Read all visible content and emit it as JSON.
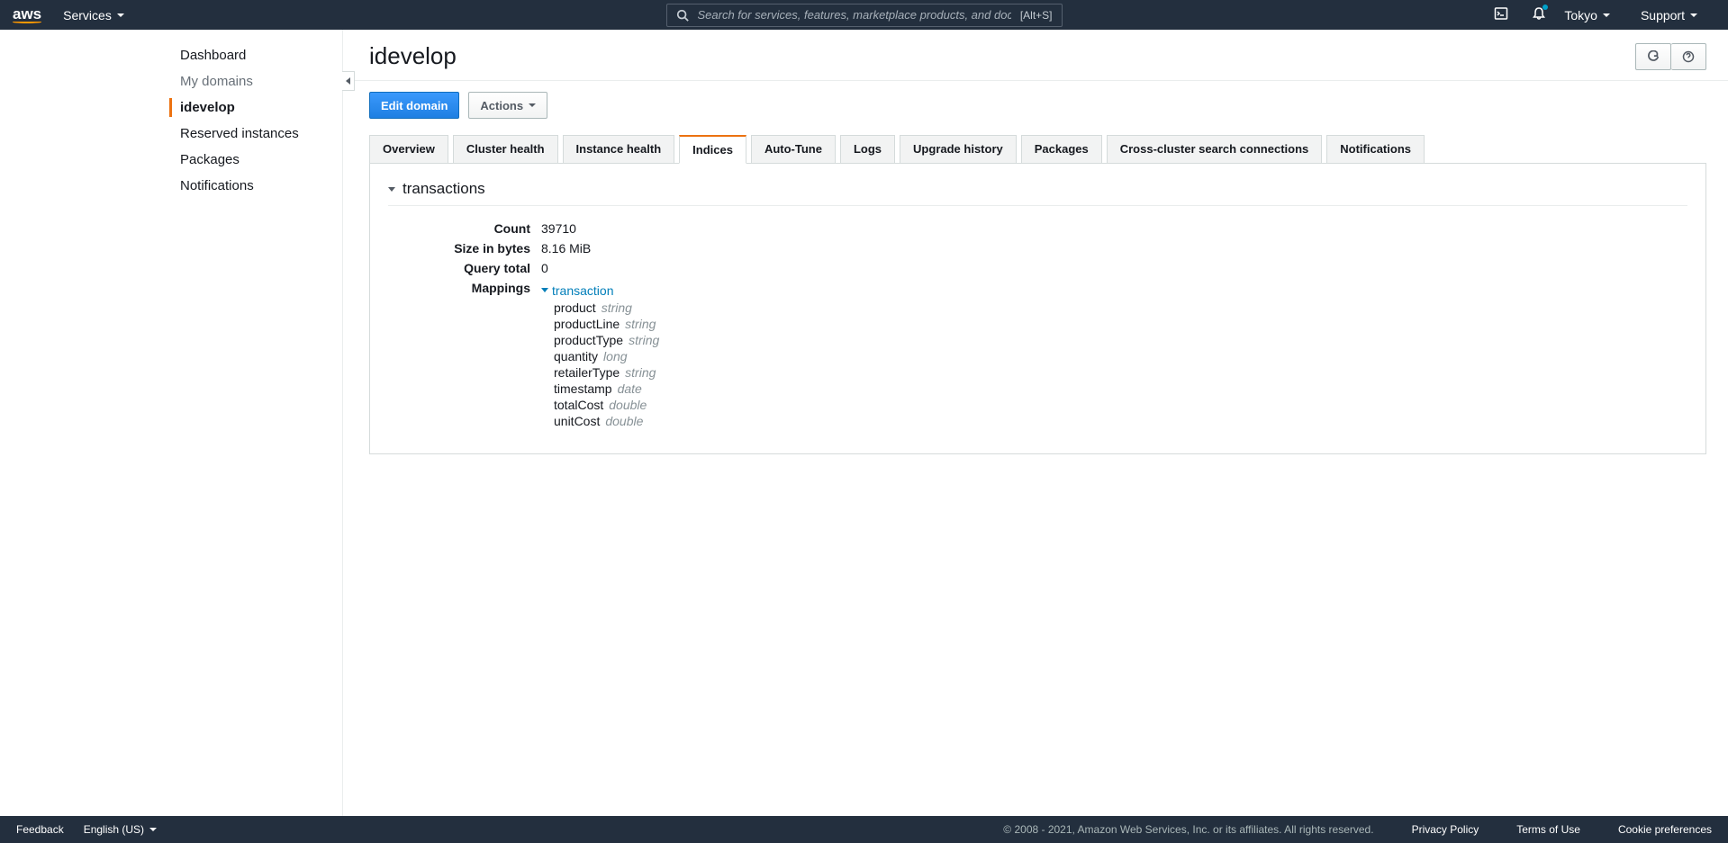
{
  "topnav": {
    "services_label": "Services",
    "search_placeholder": "Search for services, features, marketplace products, and docs",
    "search_shortcut": "[Alt+S]",
    "region": "Tokyo",
    "support": "Support"
  },
  "sidebar": {
    "items": [
      {
        "label": "Dashboard",
        "active": false,
        "muted": false
      },
      {
        "label": "My domains",
        "active": false,
        "muted": true
      },
      {
        "label": "idevelop",
        "active": true,
        "muted": false
      },
      {
        "label": "Reserved instances",
        "active": false,
        "muted": false
      },
      {
        "label": "Packages",
        "active": false,
        "muted": false
      },
      {
        "label": "Notifications",
        "active": false,
        "muted": false
      }
    ]
  },
  "page": {
    "title": "idevelop",
    "edit_button": "Edit domain",
    "actions_button": "Actions"
  },
  "tabs": [
    {
      "label": "Overview",
      "active": false
    },
    {
      "label": "Cluster health",
      "active": false
    },
    {
      "label": "Instance health",
      "active": false
    },
    {
      "label": "Indices",
      "active": true
    },
    {
      "label": "Auto-Tune",
      "active": false
    },
    {
      "label": "Logs",
      "active": false
    },
    {
      "label": "Upgrade history",
      "active": false
    },
    {
      "label": "Packages",
      "active": false
    },
    {
      "label": "Cross-cluster search connections",
      "active": false
    },
    {
      "label": "Notifications",
      "active": false
    }
  ],
  "index": {
    "name": "transactions",
    "fields": {
      "count_label": "Count",
      "count_value": "39710",
      "size_label": "Size in bytes",
      "size_value": "8.16 MiB",
      "query_label": "Query total",
      "query_value": "0",
      "mappings_label": "Mappings"
    },
    "mapping_type_name": "transaction",
    "mapping_fields": [
      {
        "name": "product",
        "type": "string"
      },
      {
        "name": "productLine",
        "type": "string"
      },
      {
        "name": "productType",
        "type": "string"
      },
      {
        "name": "quantity",
        "type": "long"
      },
      {
        "name": "retailerType",
        "type": "string"
      },
      {
        "name": "timestamp",
        "type": "date"
      },
      {
        "name": "totalCost",
        "type": "double"
      },
      {
        "name": "unitCost",
        "type": "double"
      }
    ]
  },
  "footer": {
    "feedback": "Feedback",
    "language": "English (US)",
    "copyright": "© 2008 - 2021, Amazon Web Services, Inc. or its affiliates. All rights reserved.",
    "privacy": "Privacy Policy",
    "terms": "Terms of Use",
    "cookies": "Cookie preferences"
  }
}
